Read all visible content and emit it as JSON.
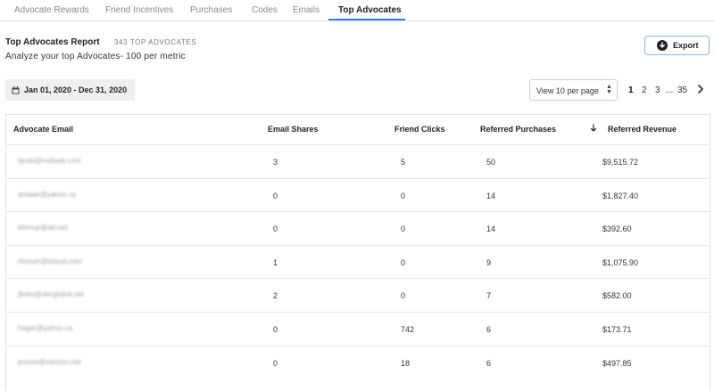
{
  "tabs": [
    {
      "label": "Advocate Rewards"
    },
    {
      "label": "Friend Incentives"
    },
    {
      "label": "Purchases"
    },
    {
      "label": "Codes"
    },
    {
      "label": "Emails"
    },
    {
      "label": "Top Advocates",
      "active": true
    }
  ],
  "report": {
    "title": "Top Advocates Report",
    "count": "343 TOP ADVOCATES",
    "subtitle": "Analyze your top Advocates- 100 per metric"
  },
  "export": {
    "label": "Export",
    "icon": "download-circle-icon"
  },
  "date_range": {
    "label": "Jan 01, 2020 - Dec 31, 2020",
    "icon": "calendar-icon"
  },
  "per_page": {
    "label": "View 10 per page",
    "icon": "select-arrows-icon"
  },
  "pagination": {
    "pages": [
      "1",
      "2",
      "3"
    ],
    "current": "1",
    "ellipsis": "...",
    "last": "35",
    "next_icon": "chevron-right-icon"
  },
  "table": {
    "columns": [
      "Advocate Email",
      "Email Shares",
      "Friend Clicks",
      "Referred Purchases",
      "Referred Revenue"
    ],
    "sort_icon": "arrow-down-icon",
    "rows": [
      {
        "email": "larold@outlook.com",
        "shares": "3",
        "clicks": "5",
        "purchases": "50",
        "revenue": "$9,515.72"
      },
      {
        "email": "ameier@yahoo.ca",
        "shares": "0",
        "clicks": "0",
        "purchases": "14",
        "revenue": "$1,827.40"
      },
      {
        "email": "bforrup@att.net",
        "shares": "0",
        "clicks": "0",
        "purchases": "14",
        "revenue": "$392.60"
      },
      {
        "email": "rhorum@icloud.com",
        "shares": "1",
        "clicks": "0",
        "purchases": "9",
        "revenue": "$1,075.90"
      },
      {
        "email": "jfinke@sbcglobal.net",
        "shares": "2",
        "clicks": "0",
        "purchases": "7",
        "revenue": "$582.00"
      },
      {
        "email": "hager@yahoo.ca",
        "shares": "0",
        "clicks": "742",
        "purchases": "6",
        "revenue": "$173.71"
      },
      {
        "email": "psnow@verizon.net",
        "shares": "0",
        "clicks": "18",
        "purchases": "6",
        "revenue": "$497.85"
      }
    ]
  },
  "colors": {
    "accent": "#2d7ff0",
    "border": "#e2e2e2",
    "muted": "#8a8a8a"
  }
}
